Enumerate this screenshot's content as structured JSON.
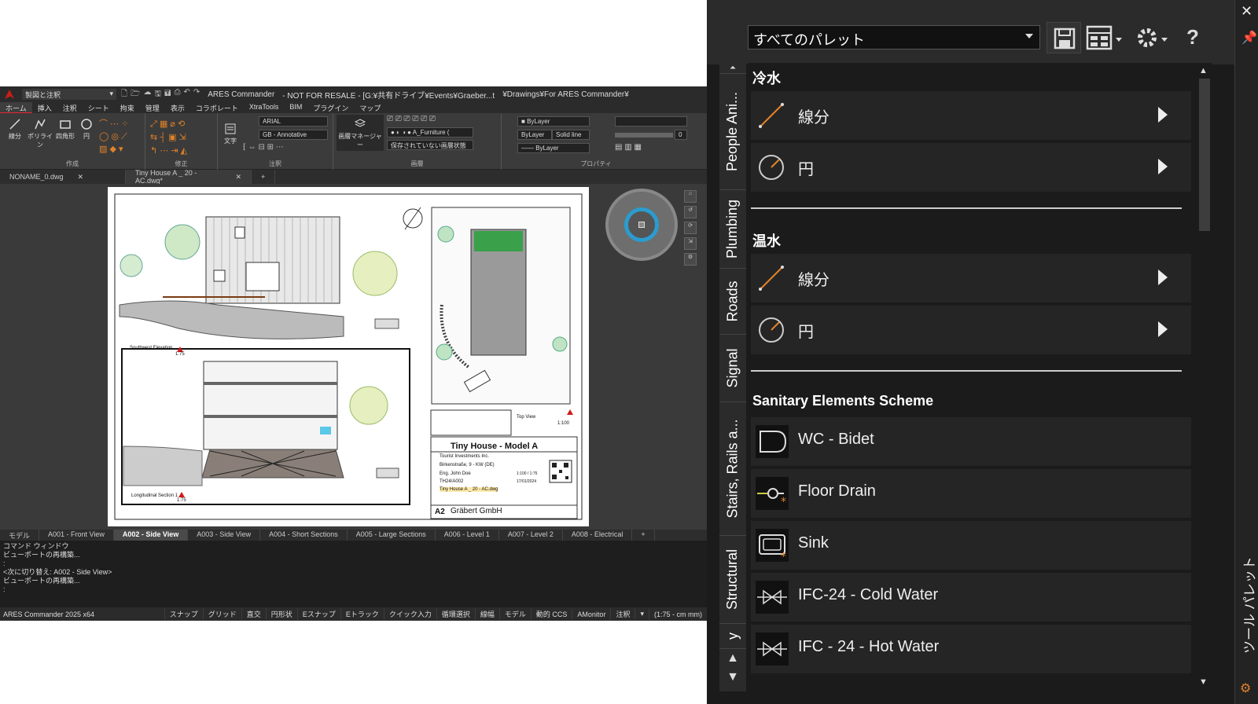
{
  "app": {
    "workspace": "製図と注釈",
    "title": "ARES Commander",
    "title_suffix": "- NOT FOR RESALE - [G:¥共有ドライブ¥Events¥Graeber...t",
    "title_path": "¥Drawings¥For ARES Commander¥"
  },
  "menu": [
    "ホーム",
    "挿入",
    "注釈",
    "シート",
    "拘束",
    "管理",
    "表示",
    "コラボレート",
    "XtraTools",
    "BIM",
    "プラグイン",
    "マップ"
  ],
  "ribbon": {
    "tools": {
      "line": "線分",
      "polyline": "ポリライン",
      "rect": "四角形",
      "circle": "円",
      "text": "文字",
      "layer_manager": "画層マネージャー"
    },
    "font": "ARIAL",
    "dimstyle": "GB - Annotative",
    "layer": "A_Furniture (",
    "layer_state": "保存されていない画層状態",
    "color": "ByLayer",
    "linetype": "ByLayer",
    "linetype_name": "Solid line",
    "lineweight": "ByLayer",
    "transparency": "0",
    "groups": {
      "draw": "作成",
      "modify": "修正",
      "annotation": "注釈",
      "layers": "画層",
      "properties": "プロパティ"
    }
  },
  "doc_tabs": [
    {
      "label": "NONAME_0.dwg"
    },
    {
      "label": "Tiny House A _ 20 - AC.dwg*"
    }
  ],
  "drawing": {
    "elevation_label": "Southwest Elevation",
    "section_label": "Longitudinal Section 1",
    "top_view": "Top View",
    "project_title": "Tiny House - Model A",
    "client": "Tourist Investments Inc.",
    "address": "Birkenstraße, 9 - KW (DE)",
    "technician": "Eng. John Doe",
    "sheet_no": "TH24/A002",
    "file": "Tiny House A _ 20 - AC.dwg",
    "sheet_size": "A2",
    "company": "Gräbert GmbH",
    "scale": "1:100 / 1:75",
    "date": "17/01/2024",
    "scale_label": "1:75",
    "top_scale": "1:100"
  },
  "layouts": [
    "モデル",
    "A001 - Front View",
    "A002 - Side View",
    "A003 - Side View",
    "A004 - Short Sections",
    "A005 - Large Sections",
    "A006 - Level 1",
    "A007 - Level 2",
    "A008 - Electrical",
    "+"
  ],
  "active_layout": "A002 - Side View",
  "command": {
    "title": "コマンド ウィンドウ",
    "lines": [
      "ビューポートの再構築...",
      ":",
      "<次に切り替え: A002 - Side View>",
      "ビューポートの再構築...",
      ":"
    ]
  },
  "status": {
    "version": "ARES Commander 2025 x64",
    "buttons": [
      "スナップ",
      "グリッド",
      "直交",
      "円形状",
      "Eスナップ",
      "Eトラック",
      "クイック入力",
      "循環選択",
      "線幅",
      "モデル",
      "動的 CCS",
      "AMonitor",
      "注釈"
    ],
    "scale": "(1:75 - cm mm)"
  },
  "palette": {
    "dropdown": "すべてのパレット",
    "side_label": "ツール パレット",
    "tabs": [
      "People Ani...",
      "Plumbing",
      "Roads",
      "Signal",
      "Stairs, Rails a...",
      "Structural",
      "y"
    ],
    "sections": [
      {
        "title": "冷水",
        "items": [
          {
            "label": "線分",
            "icon": "line-icon"
          },
          {
            "label": "円",
            "icon": "circle-icon"
          }
        ]
      },
      {
        "title": "温水",
        "items": [
          {
            "label": "線分",
            "icon": "line-icon"
          },
          {
            "label": "円",
            "icon": "circle-icon"
          }
        ]
      },
      {
        "title": "Sanitary Elements Scheme",
        "items": [
          {
            "label": "WC - Bidet",
            "icon": "wc-icon"
          },
          {
            "label": "Floor Drain",
            "icon": "floor-drain-icon"
          },
          {
            "label": "Sink",
            "icon": "sink-icon"
          },
          {
            "label": "IFC-24 - Cold Water",
            "icon": "valve-icon"
          },
          {
            "label": "IFC - 24 - Hot Water",
            "icon": "valve-icon"
          }
        ]
      }
    ]
  },
  "colors": {
    "accent": "#e0822a",
    "brand": "#d01a1a",
    "nav_ring": "#2b9ccf"
  }
}
